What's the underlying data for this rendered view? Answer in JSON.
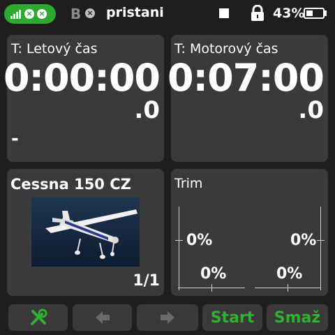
{
  "status": {
    "pill_x1": "×",
    "pill_x2": "×",
    "b_label": "B",
    "b_x": "×",
    "model_name": "pristani",
    "battery_pct": "43%",
    "battery_level": 0.43,
    "accent": "#2fa82f"
  },
  "timer1": {
    "label": "T: Letový čas",
    "time": "0:00:00",
    "fraction": ".0",
    "extra": "-"
  },
  "timer2": {
    "label": "T: Motorový čas",
    "time": "0:07:00",
    "fraction": ".0"
  },
  "model": {
    "name": "Cessna 150 CZ",
    "page": "1/1"
  },
  "trim": {
    "title": "Trim",
    "left_vertical": "0%",
    "right_vertical": "0%",
    "left_horizontal": "0%",
    "right_horizontal": "0%"
  },
  "buttons": {
    "start": "Start",
    "clear": "Smaž"
  }
}
